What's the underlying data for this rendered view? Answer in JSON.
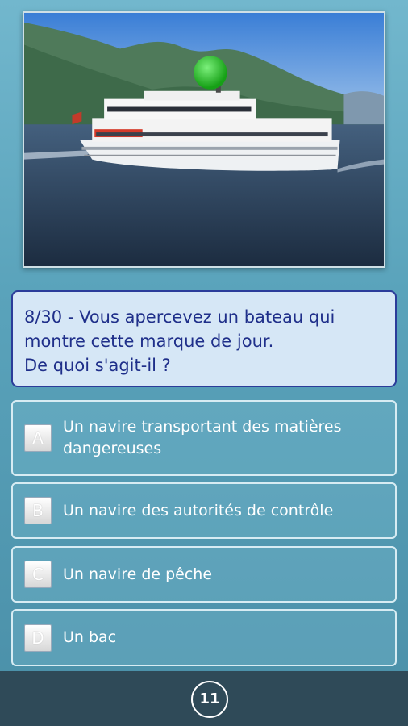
{
  "image": {
    "subject": "passenger-boat-with-green-ball"
  },
  "question": {
    "text": "8/30 - Vous apercevez un bateau qui\nmontre cette marque de jour.\nDe quoi s'agit-il ?"
  },
  "answers": [
    {
      "letter": "A",
      "text": "Un navire transportant des matières dangereuses"
    },
    {
      "letter": "B",
      "text": "Un navire des autorités de contrôle"
    },
    {
      "letter": "C",
      "text": "Un navire de pêche"
    },
    {
      "letter": "D",
      "text": "Un bac"
    }
  ],
  "footer": {
    "counter": "11"
  },
  "colors": {
    "question_border": "#2b3c9a",
    "question_bg": "#d6e7f6",
    "question_text": "#1f2f8a",
    "bottom_bar": "#2f4a58",
    "day_mark": "#22c022"
  }
}
